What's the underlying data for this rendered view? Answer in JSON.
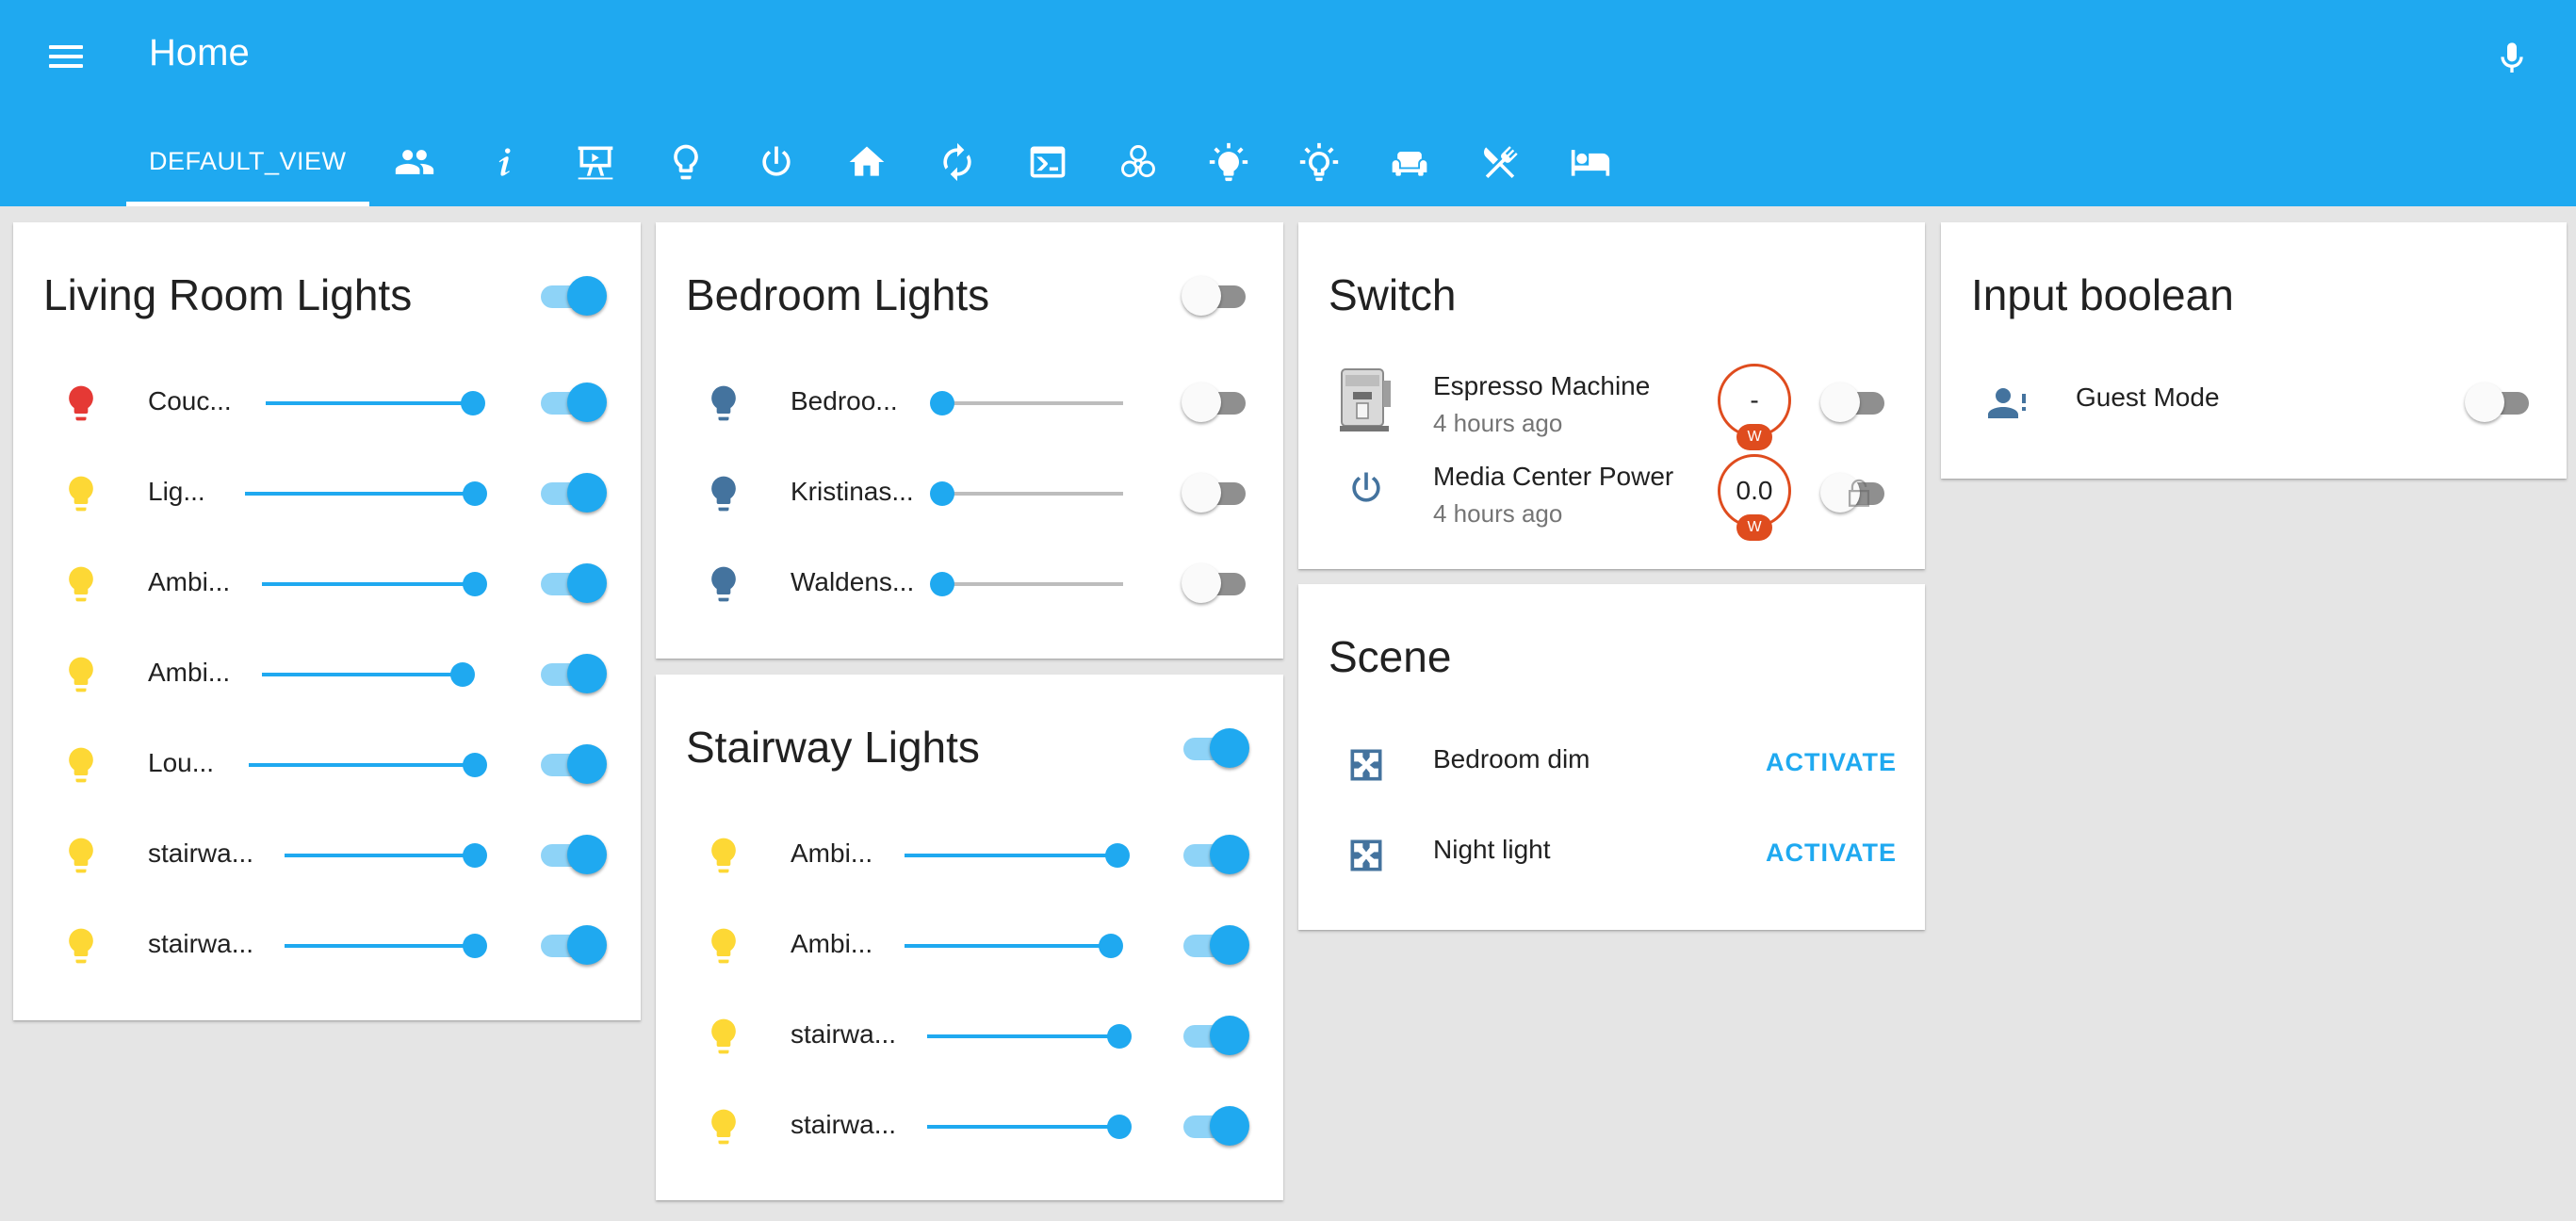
{
  "header": {
    "title": "Home",
    "menu_icon": "menu-icon",
    "mic_icon": "microphone-icon",
    "color": "#1fa9f0",
    "tabs": [
      {
        "label": "DEFAULT_VIEW",
        "selected": true
      },
      {
        "icon": "account-multiple-icon"
      },
      {
        "icon": "information-icon"
      },
      {
        "icon": "presentation-play-icon"
      },
      {
        "icon": "lightbulb-outline-icon"
      },
      {
        "icon": "power-icon"
      },
      {
        "icon": "home-icon"
      },
      {
        "icon": "refresh-icon"
      },
      {
        "icon": "console-icon"
      },
      {
        "icon": "biohazard-icon"
      },
      {
        "icon": "lightbulb-on-icon"
      },
      {
        "icon": "lightbulb-on-outline-icon"
      },
      {
        "icon": "sofa-icon"
      },
      {
        "icon": "silverware-icon"
      },
      {
        "icon": "bed-icon"
      }
    ]
  },
  "living_room": {
    "title": "Living Room Lights",
    "group_on": true,
    "items": [
      {
        "name": "Couc...",
        "icon_color": "#e53935",
        "brightness": 1.0,
        "on": true
      },
      {
        "name": "Lig...",
        "icon_color": "#fdd835",
        "brightness": 1.0,
        "on": true
      },
      {
        "name": "Ambi...",
        "icon_color": "#fdd835",
        "brightness": 1.0,
        "on": true
      },
      {
        "name": "Ambi...",
        "icon_color": "#fdd835",
        "brightness": 0.97,
        "on": true
      },
      {
        "name": "Lou...",
        "icon_color": "#fdd835",
        "brightness": 1.0,
        "on": true
      },
      {
        "name": "stairwa...",
        "icon_color": "#fdd835",
        "brightness": 1.0,
        "on": true
      },
      {
        "name": "stairwa...",
        "icon_color": "#fdd835",
        "brightness": 1.0,
        "on": true
      }
    ]
  },
  "bedroom": {
    "title": "Bedroom Lights",
    "group_on": false,
    "items": [
      {
        "name": "Bedroo...",
        "icon_color": "#44739e",
        "brightness": 0.0,
        "on": false
      },
      {
        "name": "Kristinas...",
        "icon_color": "#44739e",
        "brightness": 0.0,
        "on": false
      },
      {
        "name": "Waldens...",
        "icon_color": "#44739e",
        "brightness": 0.0,
        "on": false
      }
    ]
  },
  "stairway": {
    "title": "Stairway Lights",
    "group_on": true,
    "items": [
      {
        "name": "Ambi...",
        "icon_color": "#fdd835",
        "brightness": 1.0,
        "on": true
      },
      {
        "name": "Ambi...",
        "icon_color": "#fdd835",
        "brightness": 0.97,
        "on": true
      },
      {
        "name": "stairwa...",
        "icon_color": "#fdd835",
        "brightness": 1.0,
        "on": true
      },
      {
        "name": "stairwa...",
        "icon_color": "#fdd835",
        "brightness": 1.0,
        "on": true
      }
    ]
  },
  "switch": {
    "title": "Switch",
    "items": [
      {
        "name": "Espresso Machine",
        "time": "4 hours ago",
        "power": "-",
        "unit": "W",
        "on": false,
        "icon": "espresso-machine-image"
      },
      {
        "name": "Media Center Power",
        "time": "4 hours ago",
        "power": "0.0",
        "unit": "W",
        "on": false,
        "icon": "power-icon"
      }
    ]
  },
  "scene": {
    "title": "Scene",
    "items": [
      {
        "name": "Bedroom dim",
        "action": "ACTIVATE"
      },
      {
        "name": "Night light",
        "action": "ACTIVATE"
      }
    ]
  },
  "input_boolean": {
    "title": "Input boolean",
    "items": [
      {
        "name": "Guest Mode",
        "on": false,
        "icon": "account-alert-icon"
      }
    ]
  }
}
